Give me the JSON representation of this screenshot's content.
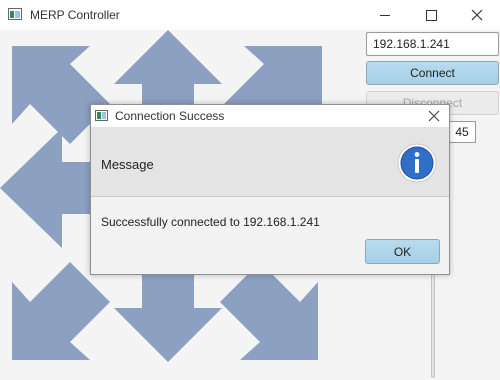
{
  "window": {
    "title": "MERP Controller"
  },
  "controls": {
    "ip_value": "192.168.1.241",
    "connect_label": "Connect",
    "disconnect_label": "Disconnect",
    "speed_value": "45"
  },
  "dialog": {
    "title": "Connection Success",
    "header": "Message",
    "message": "Successfully connected to 192.168.1.241",
    "ok_label": "OK"
  },
  "colors": {
    "arrow": "#8ca0c1",
    "accent_button": "#a5cfe6",
    "info_icon": "#2f6fc9"
  }
}
